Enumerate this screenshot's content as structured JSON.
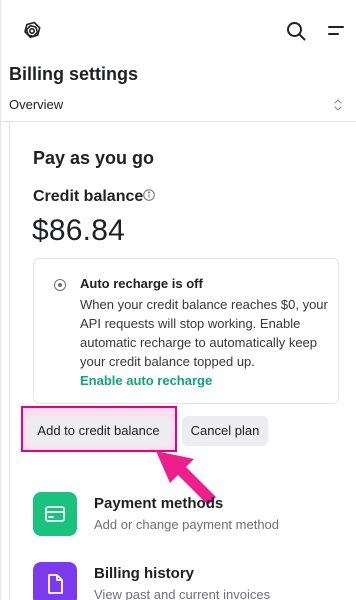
{
  "header": {
    "title": "Billing settings",
    "section_select": "Overview"
  },
  "main": {
    "heading": "Pay as you go",
    "credit_label": "Credit balance",
    "credit_amount": "$86.84",
    "notice": {
      "title": "Auto recharge is off",
      "body": "When your credit balance reaches $0, your API requests will stop working. Enable automatic recharge to automatically keep your credit balance topped up.",
      "link": "Enable auto recharge"
    },
    "buttons": {
      "add_credit": "Add to credit balance",
      "cancel_plan": "Cancel plan"
    },
    "links": [
      {
        "title": "Payment methods",
        "desc": "Add or change payment method",
        "icon": "credit-card-icon",
        "color": "#19c37d"
      },
      {
        "title": "Billing history",
        "desc": "View past and current invoices",
        "icon": "document-icon",
        "color": "#7c3aed"
      }
    ]
  },
  "colors": {
    "accent_green": "#10a37f",
    "highlight_pink": "#e8007f",
    "arrow_pink": "#ec1f8b"
  }
}
